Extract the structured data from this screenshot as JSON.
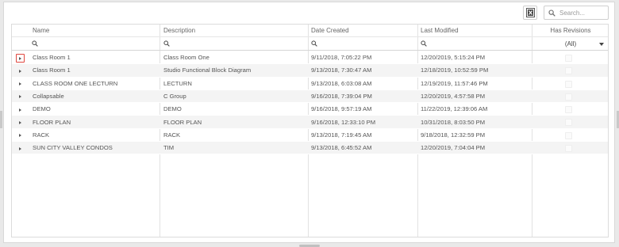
{
  "toolbar": {
    "export_icon": "excel-export-icon",
    "search_placeholder": "Search...",
    "search_icon": "search-icon"
  },
  "grid": {
    "columns": [
      {
        "key": "name",
        "label": "Name"
      },
      {
        "key": "description",
        "label": "Description"
      },
      {
        "key": "date_created",
        "label": "Date Created"
      },
      {
        "key": "last_modified",
        "label": "Last Modified"
      },
      {
        "key": "has_revisions",
        "label": "Has Revisions"
      }
    ],
    "has_revisions_filter": "(All)",
    "rows": [
      {
        "name": "Class Room 1",
        "description": "Class Room One",
        "date_created": "9/11/2018, 7:05:22 PM",
        "last_modified": "12/20/2019, 5:15:24 PM",
        "has_revisions": false
      },
      {
        "name": "Class Room 1",
        "description": "Studio Functional Block Diagram",
        "date_created": "9/13/2018, 7:30:47 AM",
        "last_modified": "12/18/2019, 10:52:59 PM",
        "has_revisions": false
      },
      {
        "name": "CLASS ROOM ONE LECTURN",
        "description": "LECTURN",
        "date_created": "9/13/2018, 6:03:08 AM",
        "last_modified": "12/19/2019, 11:57:46 PM",
        "has_revisions": false
      },
      {
        "name": "Collapsable",
        "description": "C Group",
        "date_created": "9/16/2018, 7:39:04 PM",
        "last_modified": "12/20/2019, 4:57:58 PM",
        "has_revisions": false
      },
      {
        "name": "DEMO",
        "description": "DEMO",
        "date_created": "9/16/2018, 9:57:19 AM",
        "last_modified": "11/22/2019, 12:39:06 AM",
        "has_revisions": false
      },
      {
        "name": "FLOOR PLAN",
        "description": "FLOOR PLAN",
        "date_created": "9/16/2018, 12:33:10 PM",
        "last_modified": "10/31/2018, 8:03:50 PM",
        "has_revisions": false
      },
      {
        "name": "RACK",
        "description": "RACK",
        "date_created": "9/13/2018, 7:19:45 AM",
        "last_modified": "9/18/2018, 12:32:59 PM",
        "has_revisions": false
      },
      {
        "name": "SUN CITY VALLEY CONDOS",
        "description": "TIM",
        "date_created": "9/13/2018, 6:45:52 AM",
        "last_modified": "12/20/2019, 7:04:04 PM",
        "has_revisions": false
      }
    ]
  },
  "colors": {
    "focus_outline": "#e0473f",
    "alt_row": "#f4f4f4"
  }
}
